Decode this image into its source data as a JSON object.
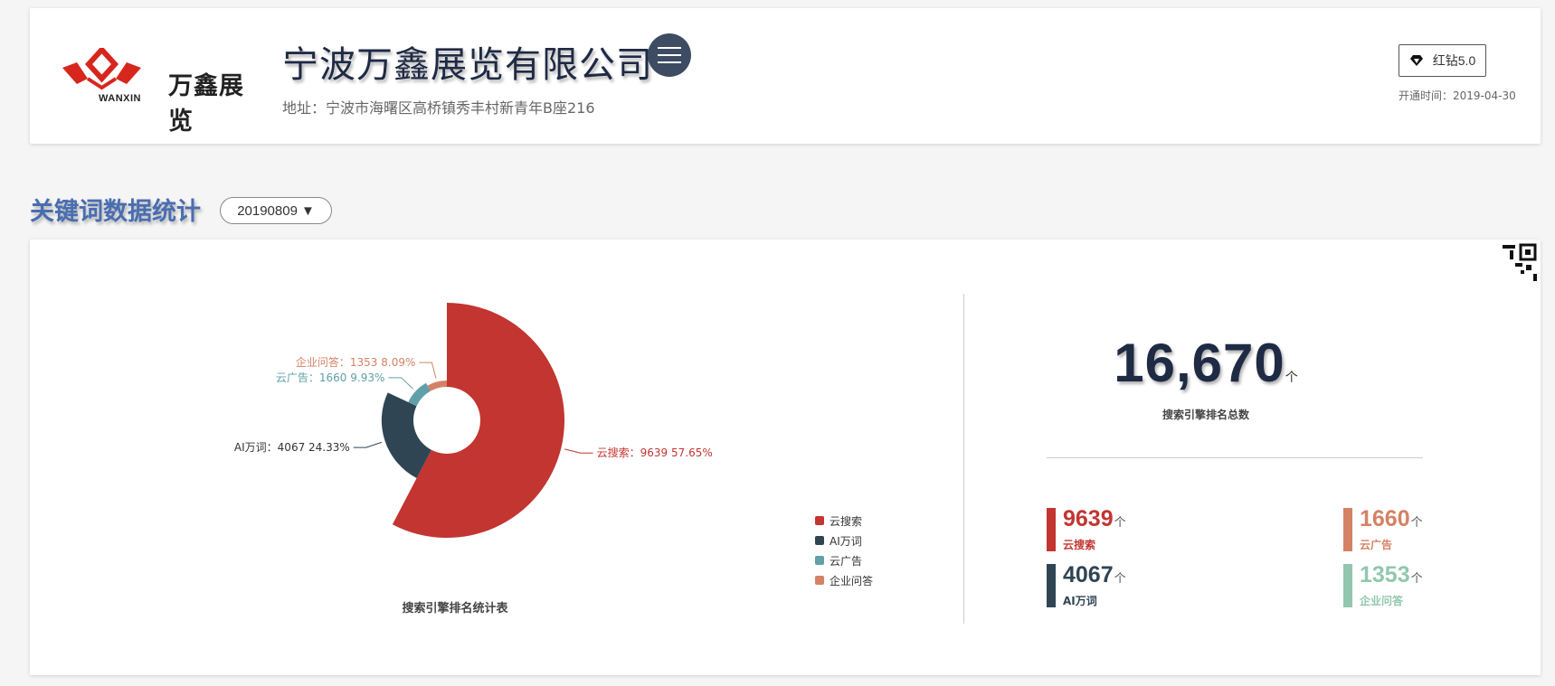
{
  "header": {
    "logo_text": "万鑫展览",
    "logo_sub": "WANXIN",
    "company_name": "宁波万鑫展览有限公司",
    "address": "地址：宁波市海曙区高桥镇秀丰村新青年B座216",
    "badge_label": "红钻5.0",
    "open_time": "开通时间：2019-04-30"
  },
  "section": {
    "title": "关键词数据统计",
    "date_value": "20190809"
  },
  "colors": {
    "yun_search": "#c23531",
    "ai_words": "#2f4554",
    "yun_ad": "#61a0a8",
    "qa": "#d48265",
    "stat_qa": "#91c7ae"
  },
  "chart_data": {
    "type": "pie",
    "title": "搜索引擎排名统计表",
    "categories": [
      "云搜索",
      "AI万词",
      "云广告",
      "企业问答"
    ],
    "values": [
      9639,
      4067,
      1660,
      1353
    ],
    "percents": [
      "57.65%",
      "24.33%",
      "9.93%",
      "8.09%"
    ],
    "slice_labels": [
      "云搜索：9639   57.65%",
      "AI万词：4067   24.33%",
      "云广告：1660   9.93%",
      "企业问答：1353   8.09%"
    ],
    "legend": [
      "云搜索",
      "AI万词",
      "云广告",
      "企业问答"
    ],
    "rose_type": "radius",
    "legend_position": "bottom-right"
  },
  "summary": {
    "total_value": "16,670",
    "total_unit": "个",
    "total_label": "搜索引擎排名总数",
    "stats": [
      {
        "value": "9639",
        "unit": "个",
        "label": "云搜索"
      },
      {
        "value": "1660",
        "unit": "个",
        "label": "云广告"
      },
      {
        "value": "4067",
        "unit": "个",
        "label": "AI万词"
      },
      {
        "value": "1353",
        "unit": "个",
        "label": "企业问答"
      }
    ]
  },
  "icons": {
    "menu": "menu-icon",
    "diamond": "diamond-icon",
    "dropdown": "caret-down-icon",
    "qr": "qr-code-icon"
  }
}
